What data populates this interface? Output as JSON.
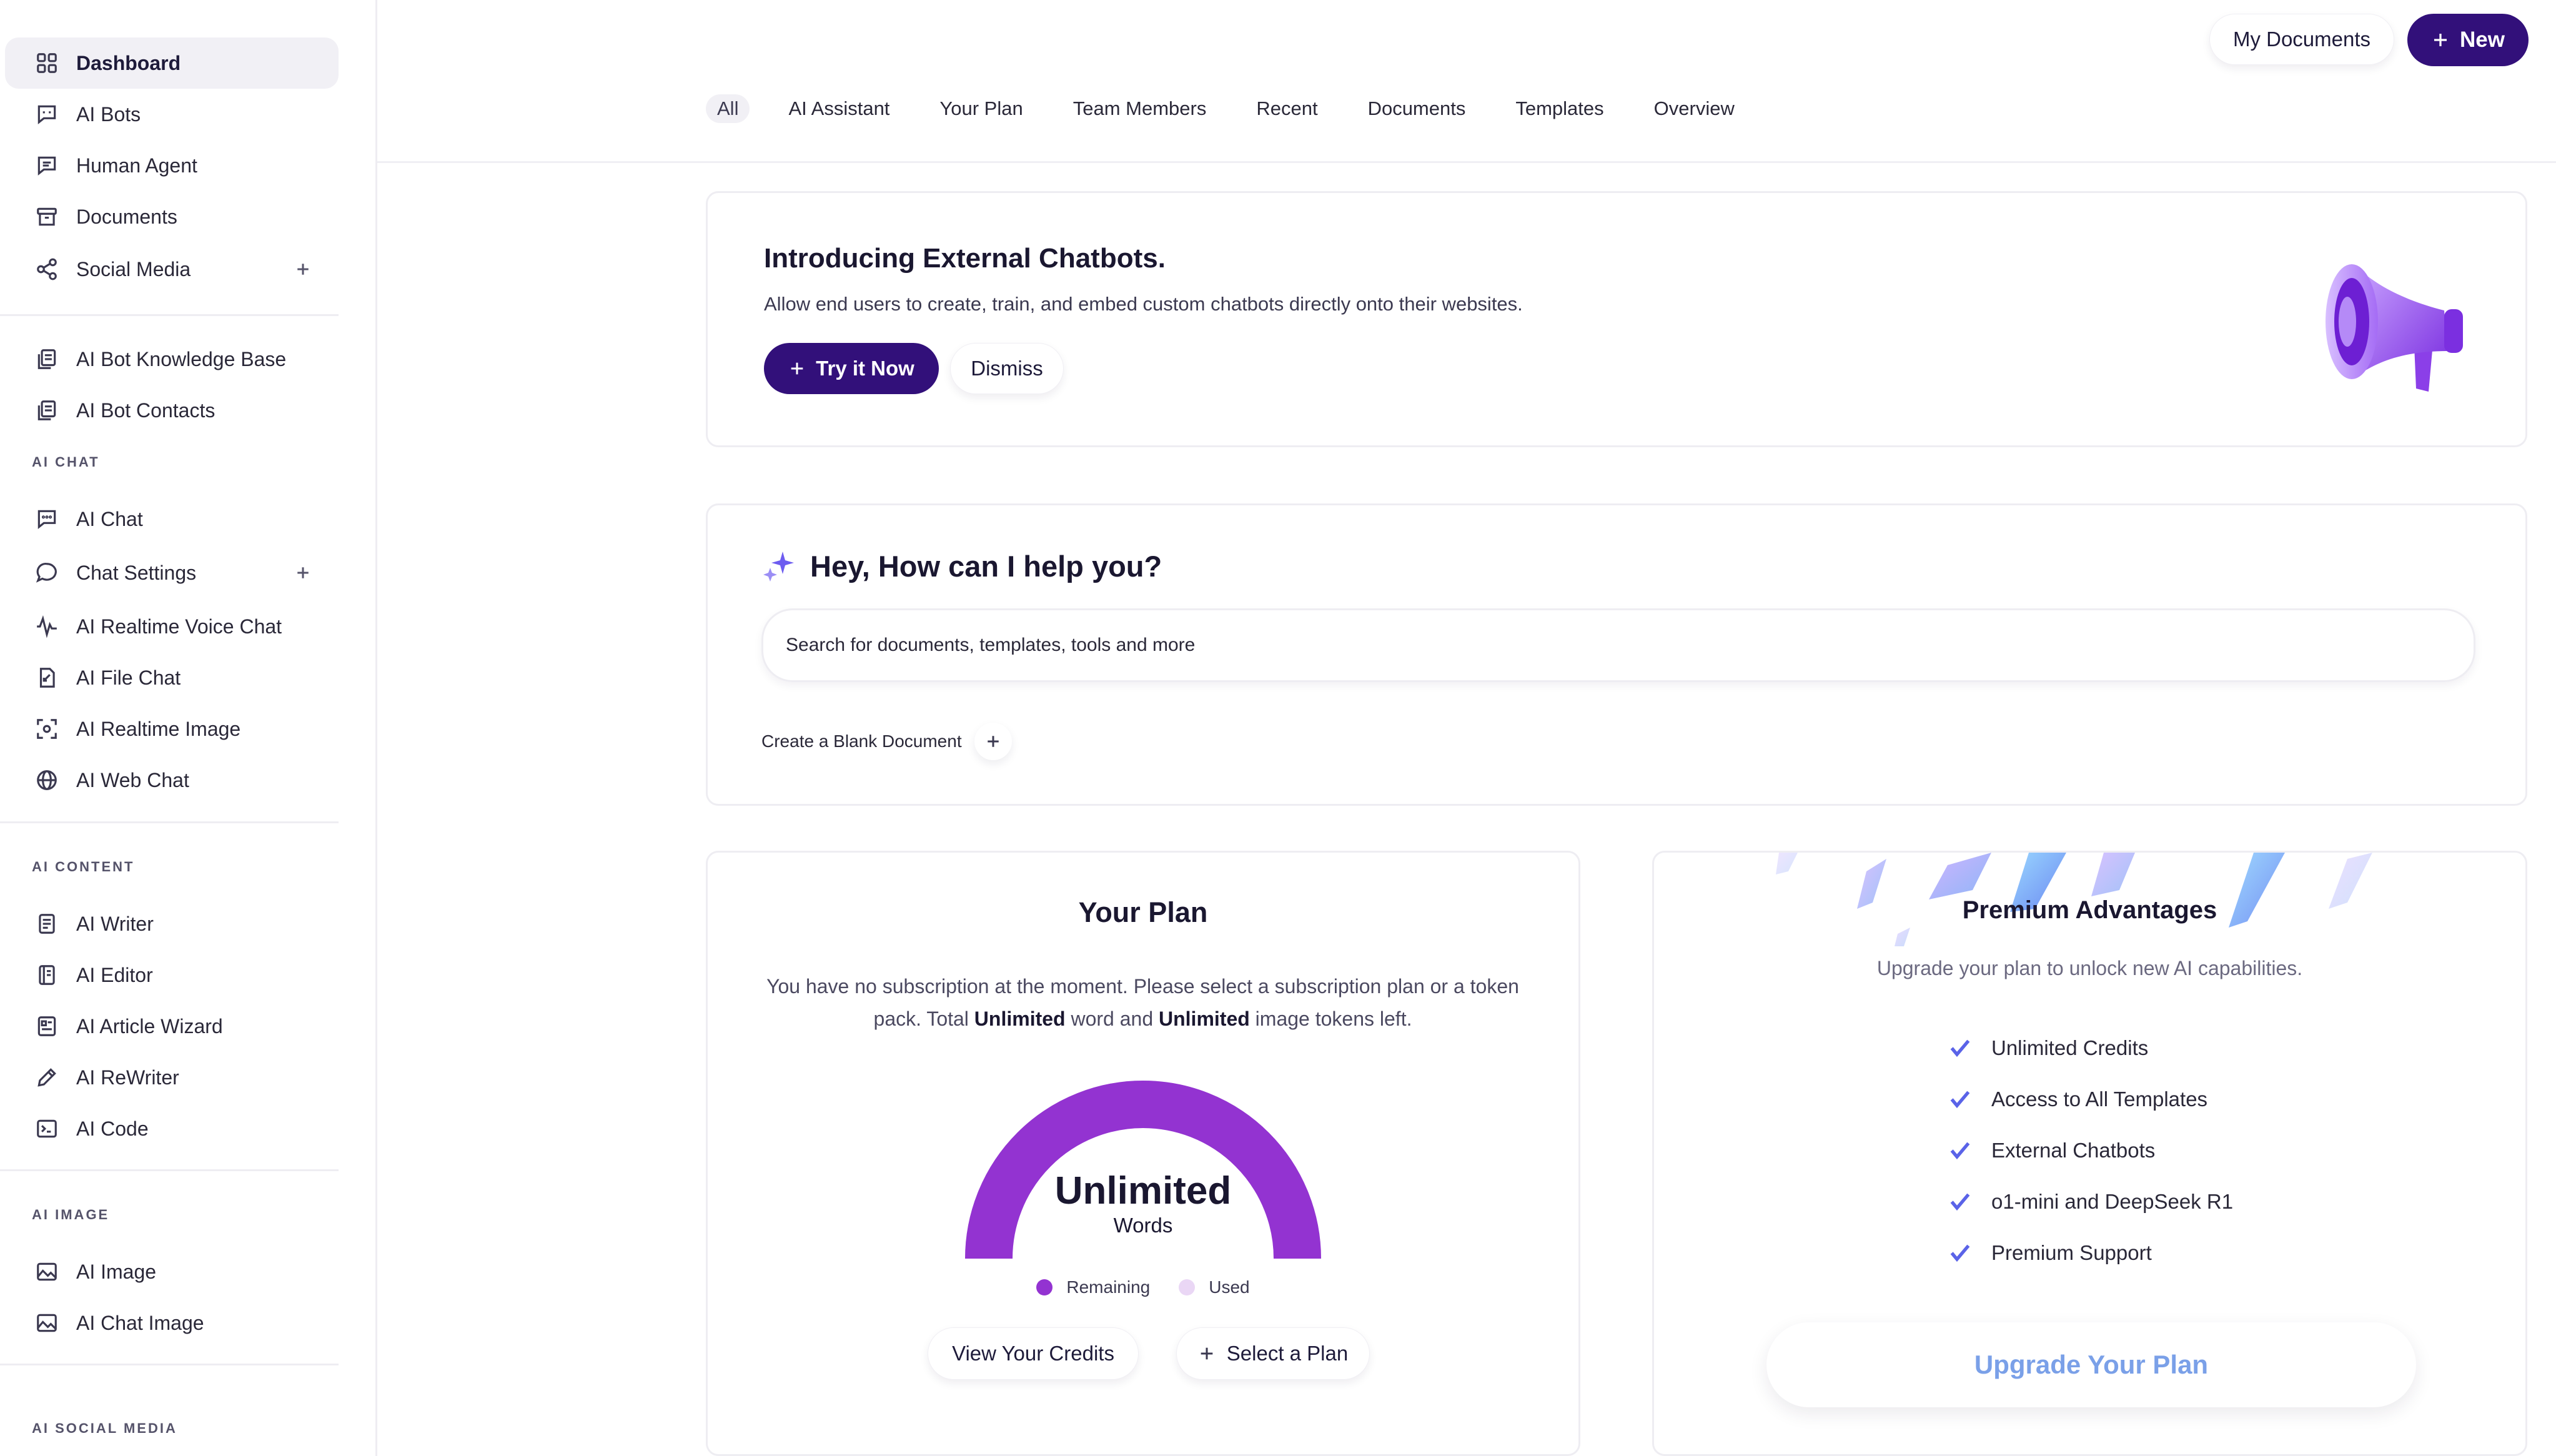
{
  "sidebar": {
    "items": [
      {
        "label": "Dashboard"
      },
      {
        "label": "AI Bots"
      },
      {
        "label": "Human Agent"
      },
      {
        "label": "Documents"
      },
      {
        "label": "Social Media"
      },
      {
        "label": "AI Bot Knowledge Base"
      },
      {
        "label": "AI Bot Contacts"
      },
      {
        "label": "AI Chat"
      },
      {
        "label": "Chat Settings"
      },
      {
        "label": "AI Realtime Voice Chat"
      },
      {
        "label": "AI File Chat"
      },
      {
        "label": "AI Realtime Image"
      },
      {
        "label": "AI Web Chat"
      },
      {
        "label": "AI Writer"
      },
      {
        "label": "AI Editor"
      },
      {
        "label": "AI Article Wizard"
      },
      {
        "label": "AI ReWriter"
      },
      {
        "label": "AI Code"
      },
      {
        "label": "AI Image"
      },
      {
        "label": "AI Chat Image"
      }
    ],
    "sections": {
      "ai_chat": "AI CHAT",
      "ai_content": "AI CONTENT",
      "ai_image": "AI IMAGE",
      "ai_social_media": "AI SOCIAL MEDIA"
    }
  },
  "header": {
    "my_documents": "My Documents",
    "new": "New",
    "tabs": [
      {
        "label": "All"
      },
      {
        "label": "AI Assistant"
      },
      {
        "label": "Your Plan"
      },
      {
        "label": "Team Members"
      },
      {
        "label": "Recent"
      },
      {
        "label": "Documents"
      },
      {
        "label": "Templates"
      },
      {
        "label": "Overview"
      }
    ]
  },
  "promo": {
    "title": "Introducing External Chatbots.",
    "description": "Allow end users to create, train, and embed custom chatbots directly onto their websites.",
    "try_label": "Try it Now",
    "dismiss_label": "Dismiss"
  },
  "assistant": {
    "title": "Hey, How can I help you?",
    "search_placeholder": "Search for documents, templates, tools and more",
    "blank_document": "Create a Blank Document"
  },
  "plan": {
    "title": "Your Plan",
    "desc_part1": "You have no subscription at the moment. Please select a subscription plan or a token pack. Total ",
    "desc_bold1": "Unlimited",
    "desc_part2": " word and ",
    "desc_bold2": "Unlimited",
    "desc_part3": " image tokens left.",
    "gauge_value": "Unlimited",
    "gauge_unit": "Words",
    "remaining_fraction": 1.0,
    "legend_remaining": "Remaining",
    "legend_used": "Used",
    "view_credits": "View Your Credits",
    "select_plan": "Select a Plan",
    "colors": {
      "remaining": "#9333d1",
      "used": "#ead7f5"
    }
  },
  "premium": {
    "title": "Premium Advantages",
    "subtitle": "Upgrade your plan to unlock new AI capabilities.",
    "features": [
      "Unlimited Credits",
      "Access to All Templates",
      "External Chatbots",
      "o1-mini and DeepSeek R1",
      "Premium Support"
    ],
    "upgrade_label": "Upgrade Your Plan"
  },
  "colors": {
    "brand": "#32107a",
    "accent_purple": "#9333d1",
    "check": "#5a63e8"
  }
}
